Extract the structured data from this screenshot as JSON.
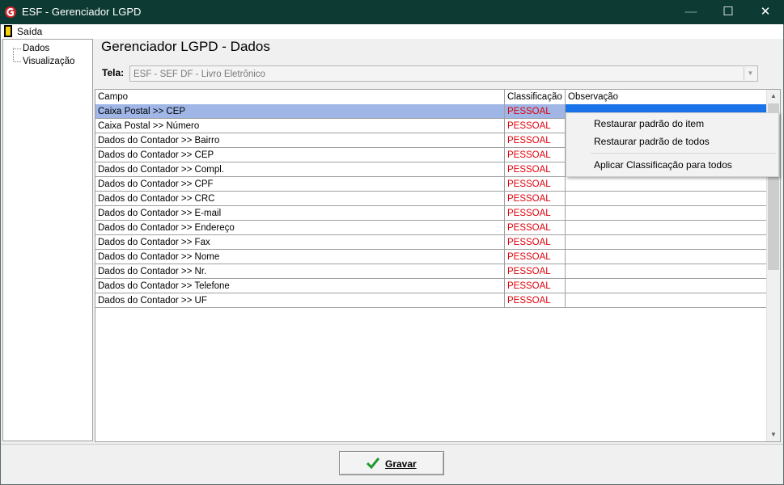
{
  "window": {
    "title": "ESF - Gerenciador LGPD",
    "minimize_glyph": "—",
    "maximize_glyph": "☐",
    "close_glyph": "✕"
  },
  "menu": {
    "exit_label": "Saída"
  },
  "tree": {
    "items": [
      "Dados",
      "Visualização"
    ]
  },
  "main": {
    "title": "Gerenciador LGPD - Dados",
    "tela_label": "Tela:",
    "tela_value": "ESF - SEF DF - Livro Eletrônico"
  },
  "grid": {
    "columns": [
      "Campo",
      "Classificação",
      "Observação"
    ],
    "rows": [
      {
        "campo": "Caixa Postal >> CEP",
        "classificacao": "PESSOAL",
        "observacao": ""
      },
      {
        "campo": "Caixa Postal >> Número",
        "classificacao": "PESSOAL",
        "observacao": ""
      },
      {
        "campo": "Dados do Contador >> Bairro",
        "classificacao": "PESSOAL",
        "observacao": ""
      },
      {
        "campo": "Dados do Contador >> CEP",
        "classificacao": "PESSOAL",
        "observacao": ""
      },
      {
        "campo": "Dados do Contador >> Compl.",
        "classificacao": "PESSOAL",
        "observacao": ""
      },
      {
        "campo": "Dados do Contador >> CPF",
        "classificacao": "PESSOAL",
        "observacao": ""
      },
      {
        "campo": "Dados do Contador >> CRC",
        "classificacao": "PESSOAL",
        "observacao": ""
      },
      {
        "campo": "Dados do Contador >> E-mail",
        "classificacao": "PESSOAL",
        "observacao": ""
      },
      {
        "campo": "Dados do Contador >> Endereço",
        "classificacao": "PESSOAL",
        "observacao": ""
      },
      {
        "campo": "Dados do Contador >> Fax",
        "classificacao": "PESSOAL",
        "observacao": ""
      },
      {
        "campo": "Dados do Contador >> Nome",
        "classificacao": "PESSOAL",
        "observacao": ""
      },
      {
        "campo": "Dados do Contador >> Nr.",
        "classificacao": "PESSOAL",
        "observacao": ""
      },
      {
        "campo": "Dados do Contador >> Telefone",
        "classificacao": "PESSOAL",
        "observacao": ""
      },
      {
        "campo": "Dados do Contador >> UF",
        "classificacao": "PESSOAL",
        "observacao": ""
      }
    ]
  },
  "context_menu": {
    "items": [
      "Restaurar padrão do item",
      "Restaurar padrão de todos",
      "Aplicar Classificação para todos"
    ]
  },
  "footer": {
    "save_label": "Gravar"
  },
  "colors": {
    "titlebar": "#0d3b34",
    "classification_text": "#e0000b",
    "selected_row": "#9fb6e6",
    "selected_cell": "#1a73e8",
    "save_check": "#1f9a2c"
  },
  "icons": {
    "app": "esf-logo-icon",
    "exit": "exit-door-icon",
    "save": "check-icon"
  }
}
